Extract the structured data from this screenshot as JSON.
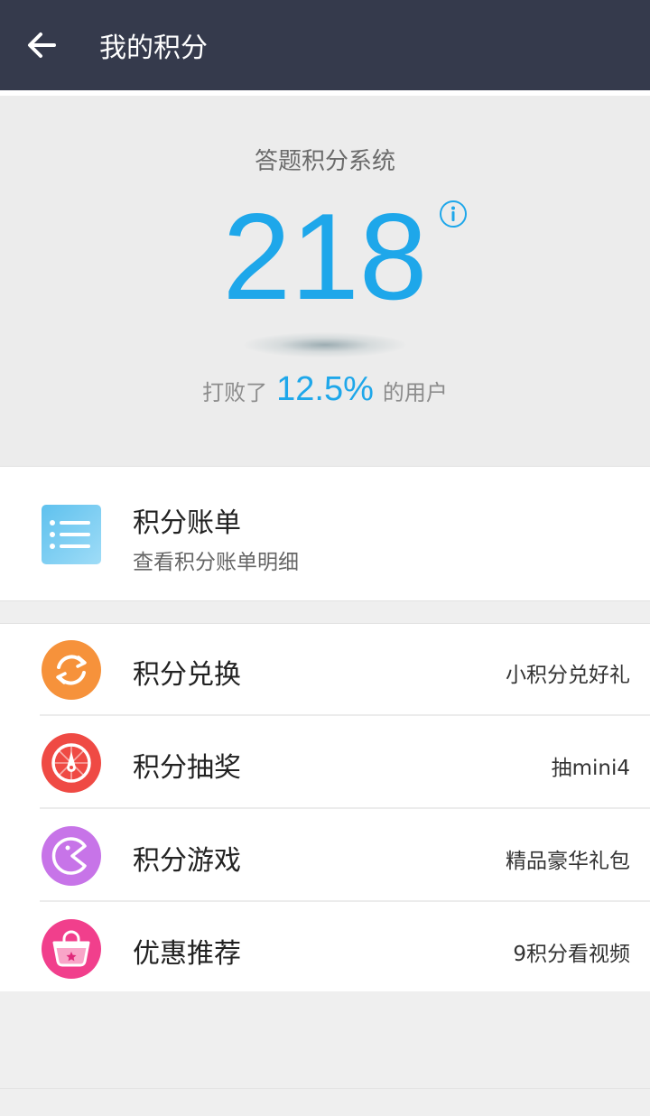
{
  "header": {
    "title": "我的积分",
    "back_icon": "arrow-left-icon"
  },
  "score": {
    "system_label": "答题积分系统",
    "value": "218",
    "info_icon": "info-icon",
    "beat_prefix": "打败了",
    "beat_percent": "12.5%",
    "beat_suffix": "的用户"
  },
  "bill": {
    "icon": "list-icon",
    "title": "积分账单",
    "subtitle": "查看积分账单明细"
  },
  "menu": [
    {
      "icon": "exchange-icon",
      "label": "积分兑换",
      "hint": "小积分兑好礼",
      "color": "#f6923b"
    },
    {
      "icon": "lottery-wheel-icon",
      "label": "积分抽奖",
      "hint": "抽mini4",
      "color": "#ef4a44"
    },
    {
      "icon": "pacman-game-icon",
      "label": "积分游戏",
      "hint": "精品豪华礼包",
      "color": "#c774e8"
    },
    {
      "icon": "shopping-bag-icon",
      "label": "优惠推荐",
      "hint": "9积分看视频",
      "color": "#f13f8c"
    }
  ],
  "colors": {
    "header_bg": "#353a4c",
    "accent": "#1ea7ea"
  }
}
